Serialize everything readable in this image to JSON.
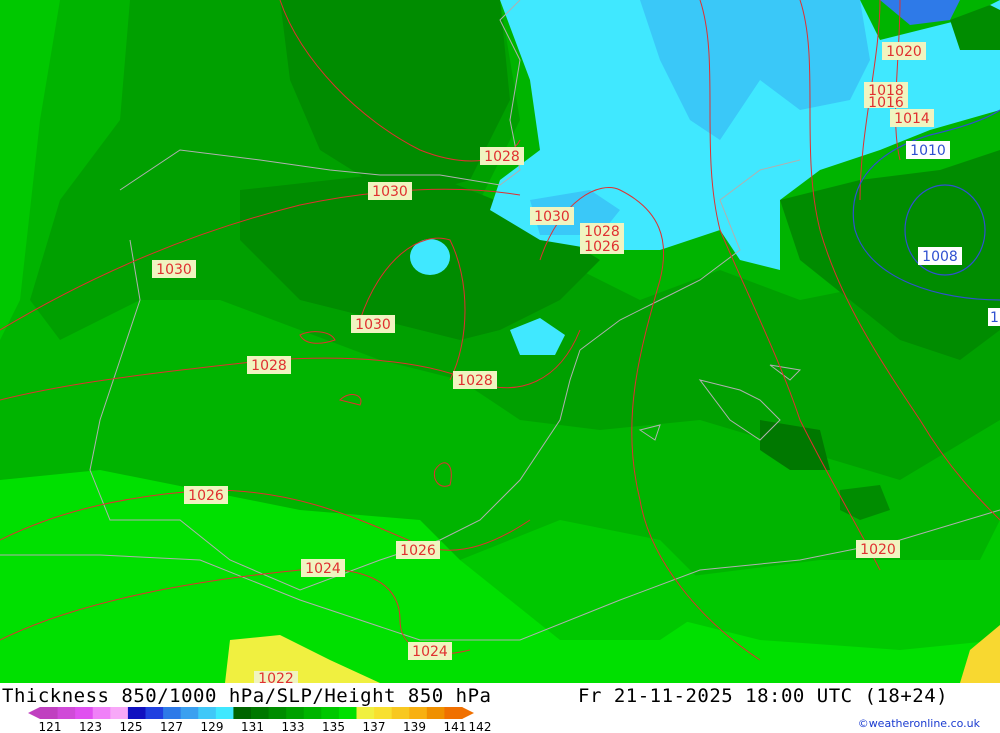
{
  "title": {
    "left": "Thickness 850/1000 hPa/SLP/Height 850 hPa",
    "right": "Fr 21-11-2025 18:00 UTC (18+24)"
  },
  "credit": "©weatheronline.co.uk",
  "legend": {
    "labels": [
      "121",
      "123",
      "125",
      "127",
      "129",
      "131",
      "133",
      "135",
      "137",
      "139",
      "141",
      "142"
    ],
    "colors": [
      "#c040c0",
      "#d04ad8",
      "#e050f0",
      "#f080f8",
      "#f8a8f8",
      "#1010c0",
      "#2040e0",
      "#2e7ae8",
      "#3aa0f0",
      "#40c8f8",
      "#40e8ff",
      "#006400",
      "#007800",
      "#008c00",
      "#00a000",
      "#00b400",
      "#00c800",
      "#00e000",
      "#f0f040",
      "#f8e030",
      "#f8c820",
      "#f8b010",
      "#f09000",
      "#f07000"
    ]
  },
  "isobars": [
    {
      "label": "1028",
      "color": "#e03030"
    },
    {
      "label": "1030",
      "color": "#e03030"
    },
    {
      "label": "1030",
      "color": "#e03030"
    },
    {
      "label": "1030",
      "color": "#e03030"
    },
    {
      "label": "1030",
      "color": "#e03030"
    },
    {
      "label": "1028",
      "color": "#e03030"
    },
    {
      "label": "1026",
      "color": "#e03030"
    },
    {
      "label": "1028",
      "color": "#e03030"
    },
    {
      "label": "1028",
      "color": "#e03030"
    },
    {
      "label": "1026",
      "color": "#e03030"
    },
    {
      "label": "1026",
      "color": "#e03030"
    },
    {
      "label": "1024",
      "color": "#e03030"
    },
    {
      "label": "1024",
      "color": "#e03030"
    },
    {
      "label": "1022",
      "color": "#e03030"
    },
    {
      "label": "1020",
      "color": "#e03030"
    },
    {
      "label": "1020",
      "color": "#e03030"
    },
    {
      "label": "1018",
      "color": "#e03030"
    },
    {
      "label": "1016",
      "color": "#e03030"
    },
    {
      "label": "1014",
      "color": "#e03030"
    },
    {
      "label": "1010",
      "color": "#3050d0"
    },
    {
      "label": "1008",
      "color": "#3050d0"
    },
    {
      "label": "1",
      "color": "#3050d0"
    }
  ]
}
